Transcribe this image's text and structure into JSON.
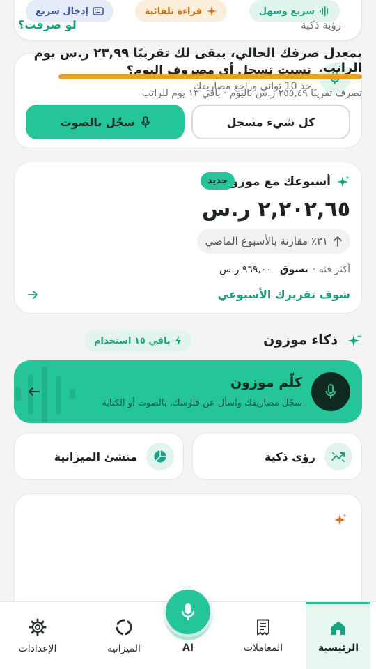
{
  "quick_actions": {
    "quick_label": "سريع وسهل",
    "auto_read_label": "قراءة تلقائية",
    "quick_entry_label": "إدخال سريع"
  },
  "reminder": {
    "title": "نسيت تسجل أي مصروف اليوم؟",
    "subtitle": "خذ 10 ثواني وراجع مصاريفك",
    "all_recorded_label": "كل شيء مسجل",
    "record_voice_label": "سجّل بالصوت"
  },
  "weekly": {
    "title": "أسبوعك مع موزون",
    "badge": "جديد",
    "amount": "٢,٢٠٢,٦٥ ر.س",
    "comparison": "٢١٪ مقارنة بالأسبوع الماضي",
    "top_category_label": "أكثر فئة ·",
    "top_category_name": "تسوق",
    "top_category_amount": "٩٦٩,٠٠ ر.س",
    "report_link": "شوف تقريرك الأسبوعي"
  },
  "ai_section": {
    "title": "ذكاء موزون",
    "remaining": "باقي ١٥ استخدام",
    "talk_title": "كلّم موزون",
    "talk_subtitle": "سجّل مصاريفك واسأل عن فلوسك، بالصوت أو الكتابة",
    "smart_insights": "رؤى ذكية",
    "budget_creator": "منشئ الميزانية"
  },
  "insight": {
    "label": "رؤية ذكية",
    "what_if": "لو صرفت؟",
    "text": "بمعدل صرفك الحالي، يبقى لك تقريبًا ٢٣,٩٩ ر.س يوم الراتب.",
    "progress": 1.0,
    "footer": "تصرف تقريبًا ٢٥٥,٤٩ ر.س باليوم · باقي ١٣ يوم للراتب"
  },
  "nav": {
    "home": "الرئيسية",
    "transactions": "المعاملات",
    "ai": "AI",
    "budget": "الميزانية",
    "settings": "الإعدادات"
  },
  "colors": {
    "accent": "#24c598",
    "accent_dark": "#17a37f",
    "progress": "#e9a227",
    "active_tab_bg": "#e7f6ef"
  }
}
